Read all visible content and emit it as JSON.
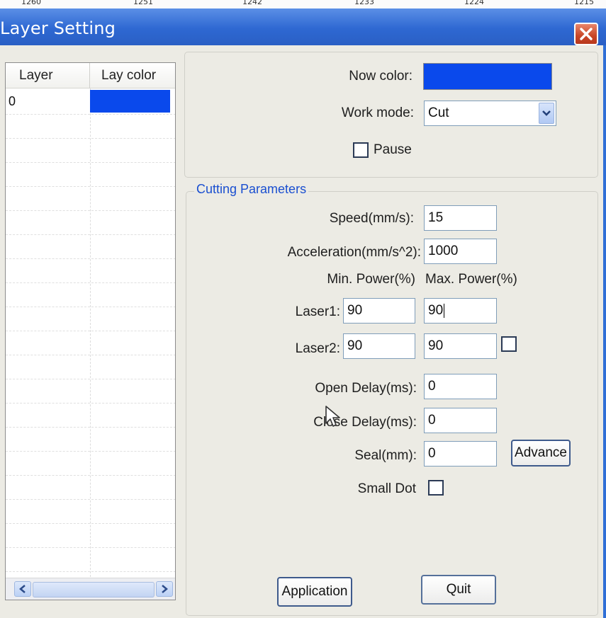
{
  "ruler": {
    "marks": [
      "1260",
      "1251",
      "1242",
      "1233",
      "1224",
      "1215"
    ]
  },
  "window": {
    "title": "Layer Setting"
  },
  "layer_list": {
    "headers": [
      "Layer",
      "Lay color"
    ],
    "rows": [
      {
        "layer": "0",
        "color": "#0a49ec"
      }
    ]
  },
  "layer_settings": {
    "now_color_label": "Now color:",
    "now_color_value": "#0a49ec",
    "work_mode_label": "Work mode:",
    "work_mode_value": "Cut",
    "pause_label": "Pause",
    "pause_checked": false
  },
  "cutting": {
    "group_title": "Cutting Parameters",
    "speed_label": "Speed(mm/s):",
    "speed_value": "15",
    "accel_label": "Acceleration(mm/s^2):",
    "accel_value": "1000",
    "min_power_header": "Min. Power(%)",
    "max_power_header": "Max. Power(%)",
    "laser1_label": "Laser1:",
    "laser1_min": "90",
    "laser1_max": "90",
    "laser2_label": "Laser2:",
    "laser2_min": "90",
    "laser2_max": "90",
    "laser2_enabled": false,
    "open_delay_label": "Open Delay(ms):",
    "open_delay_value": "0",
    "close_delay_label": "Close Delay(ms):",
    "close_delay_value": "0",
    "seal_label": "Seal(mm):",
    "seal_value": "0",
    "advance_label": "Advance",
    "small_dot_label": "Small Dot",
    "small_dot_checked": false
  },
  "footer": {
    "application_label": "Application",
    "quit_label": "Quit"
  }
}
